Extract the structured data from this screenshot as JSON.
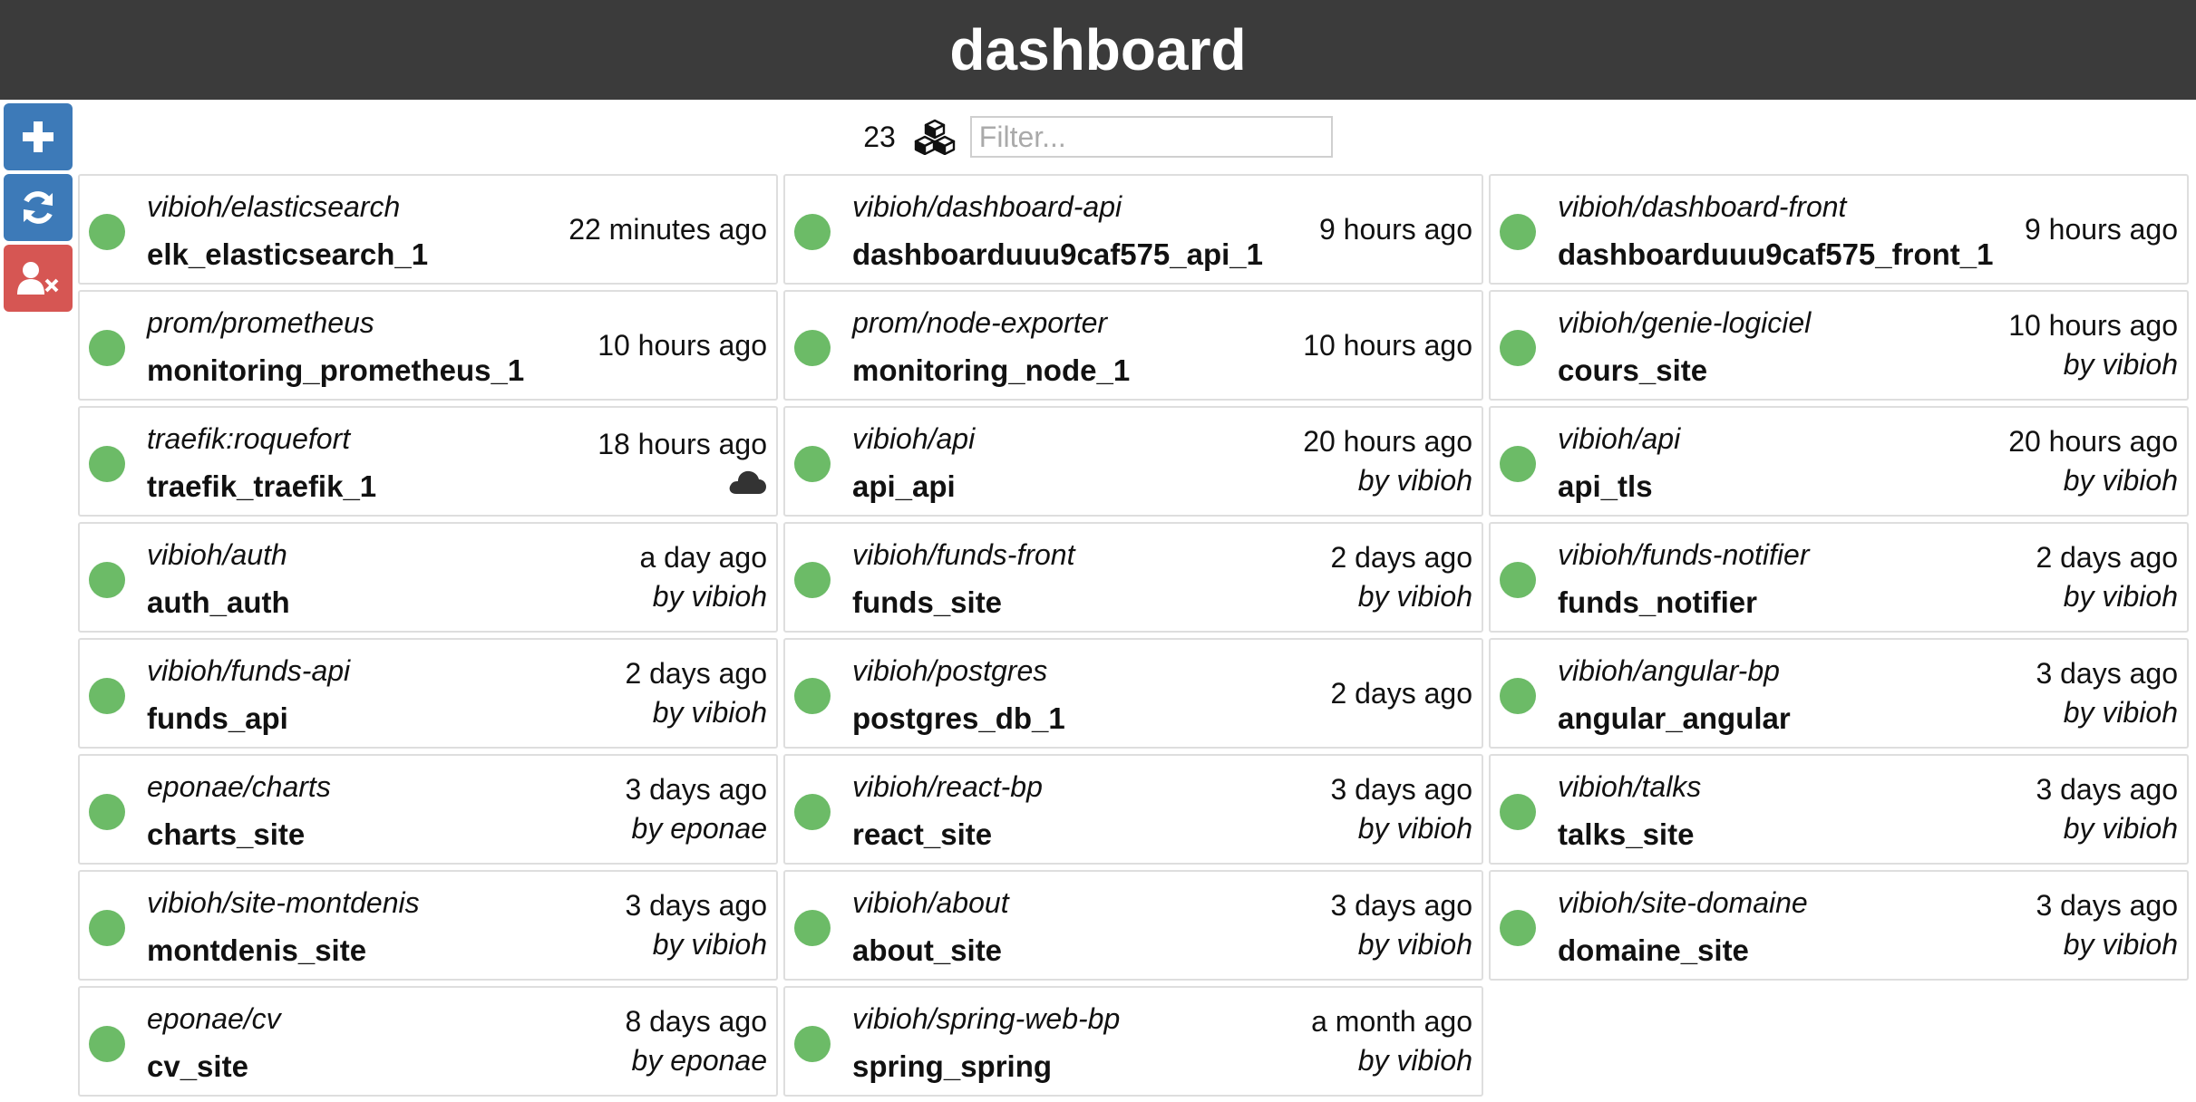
{
  "header": {
    "title": "dashboard"
  },
  "sidebar": {
    "buttons": [
      {
        "icon": "plus-icon",
        "color": "#3d7ab8"
      },
      {
        "icon": "refresh-icon",
        "color": "#3d7ab8"
      },
      {
        "icon": "user-remove-icon",
        "color": "#d65653"
      }
    ]
  },
  "toolbar": {
    "count": "23",
    "count_icon": "cubes-icon",
    "filter_placeholder": "Filter...",
    "filter_value": ""
  },
  "status_color": "#6cbb67",
  "containers": [
    {
      "image": "vibioh/elasticsearch",
      "name": "elk_elasticsearch_1",
      "time": "22 minutes ago",
      "by": ""
    },
    {
      "image": "vibioh/dashboard-api",
      "name": "dashboarduuu9caf575_api_1",
      "time": "9 hours ago",
      "by": ""
    },
    {
      "image": "vibioh/dashboard-front",
      "name": "dashboarduuu9caf575_front_1",
      "time": "9 hours ago",
      "by": ""
    },
    {
      "image": "prom/prometheus",
      "name": "monitoring_prometheus_1",
      "time": "10 hours ago",
      "by": ""
    },
    {
      "image": "prom/node-exporter",
      "name": "monitoring_node_1",
      "time": "10 hours ago",
      "by": ""
    },
    {
      "image": "vibioh/genie-logiciel",
      "name": "cours_site",
      "time": "10 hours ago",
      "by": "by vibioh"
    },
    {
      "image": "traefik:roquefort",
      "name": "traefik_traefik_1",
      "time": "18 hours ago",
      "by": "",
      "cloud": true
    },
    {
      "image": "vibioh/api",
      "name": "api_api",
      "time": "20 hours ago",
      "by": "by vibioh"
    },
    {
      "image": "vibioh/api",
      "name": "api_tls",
      "time": "20 hours ago",
      "by": "by vibioh"
    },
    {
      "image": "vibioh/auth",
      "name": "auth_auth",
      "time": "a day ago",
      "by": "by vibioh"
    },
    {
      "image": "vibioh/funds-front",
      "name": "funds_site",
      "time": "2 days ago",
      "by": "by vibioh"
    },
    {
      "image": "vibioh/funds-notifier",
      "name": "funds_notifier",
      "time": "2 days ago",
      "by": "by vibioh"
    },
    {
      "image": "vibioh/funds-api",
      "name": "funds_api",
      "time": "2 days ago",
      "by": "by vibioh"
    },
    {
      "image": "vibioh/postgres",
      "name": "postgres_db_1",
      "time": "2 days ago",
      "by": ""
    },
    {
      "image": "vibioh/angular-bp",
      "name": "angular_angular",
      "time": "3 days ago",
      "by": "by vibioh"
    },
    {
      "image": "eponae/charts",
      "name": "charts_site",
      "time": "3 days ago",
      "by": "by eponae"
    },
    {
      "image": "vibioh/react-bp",
      "name": "react_site",
      "time": "3 days ago",
      "by": "by vibioh"
    },
    {
      "image": "vibioh/talks",
      "name": "talks_site",
      "time": "3 days ago",
      "by": "by vibioh"
    },
    {
      "image": "vibioh/site-montdenis",
      "name": "montdenis_site",
      "time": "3 days ago",
      "by": "by vibioh"
    },
    {
      "image": "vibioh/about",
      "name": "about_site",
      "time": "3 days ago",
      "by": "by vibioh"
    },
    {
      "image": "vibioh/site-domaine",
      "name": "domaine_site",
      "time": "3 days ago",
      "by": "by vibioh"
    },
    {
      "image": "eponae/cv",
      "name": "cv_site",
      "time": "8 days ago",
      "by": "by eponae"
    },
    {
      "image": "vibioh/spring-web-bp",
      "name": "spring_spring",
      "time": "a month ago",
      "by": "by vibioh"
    }
  ]
}
